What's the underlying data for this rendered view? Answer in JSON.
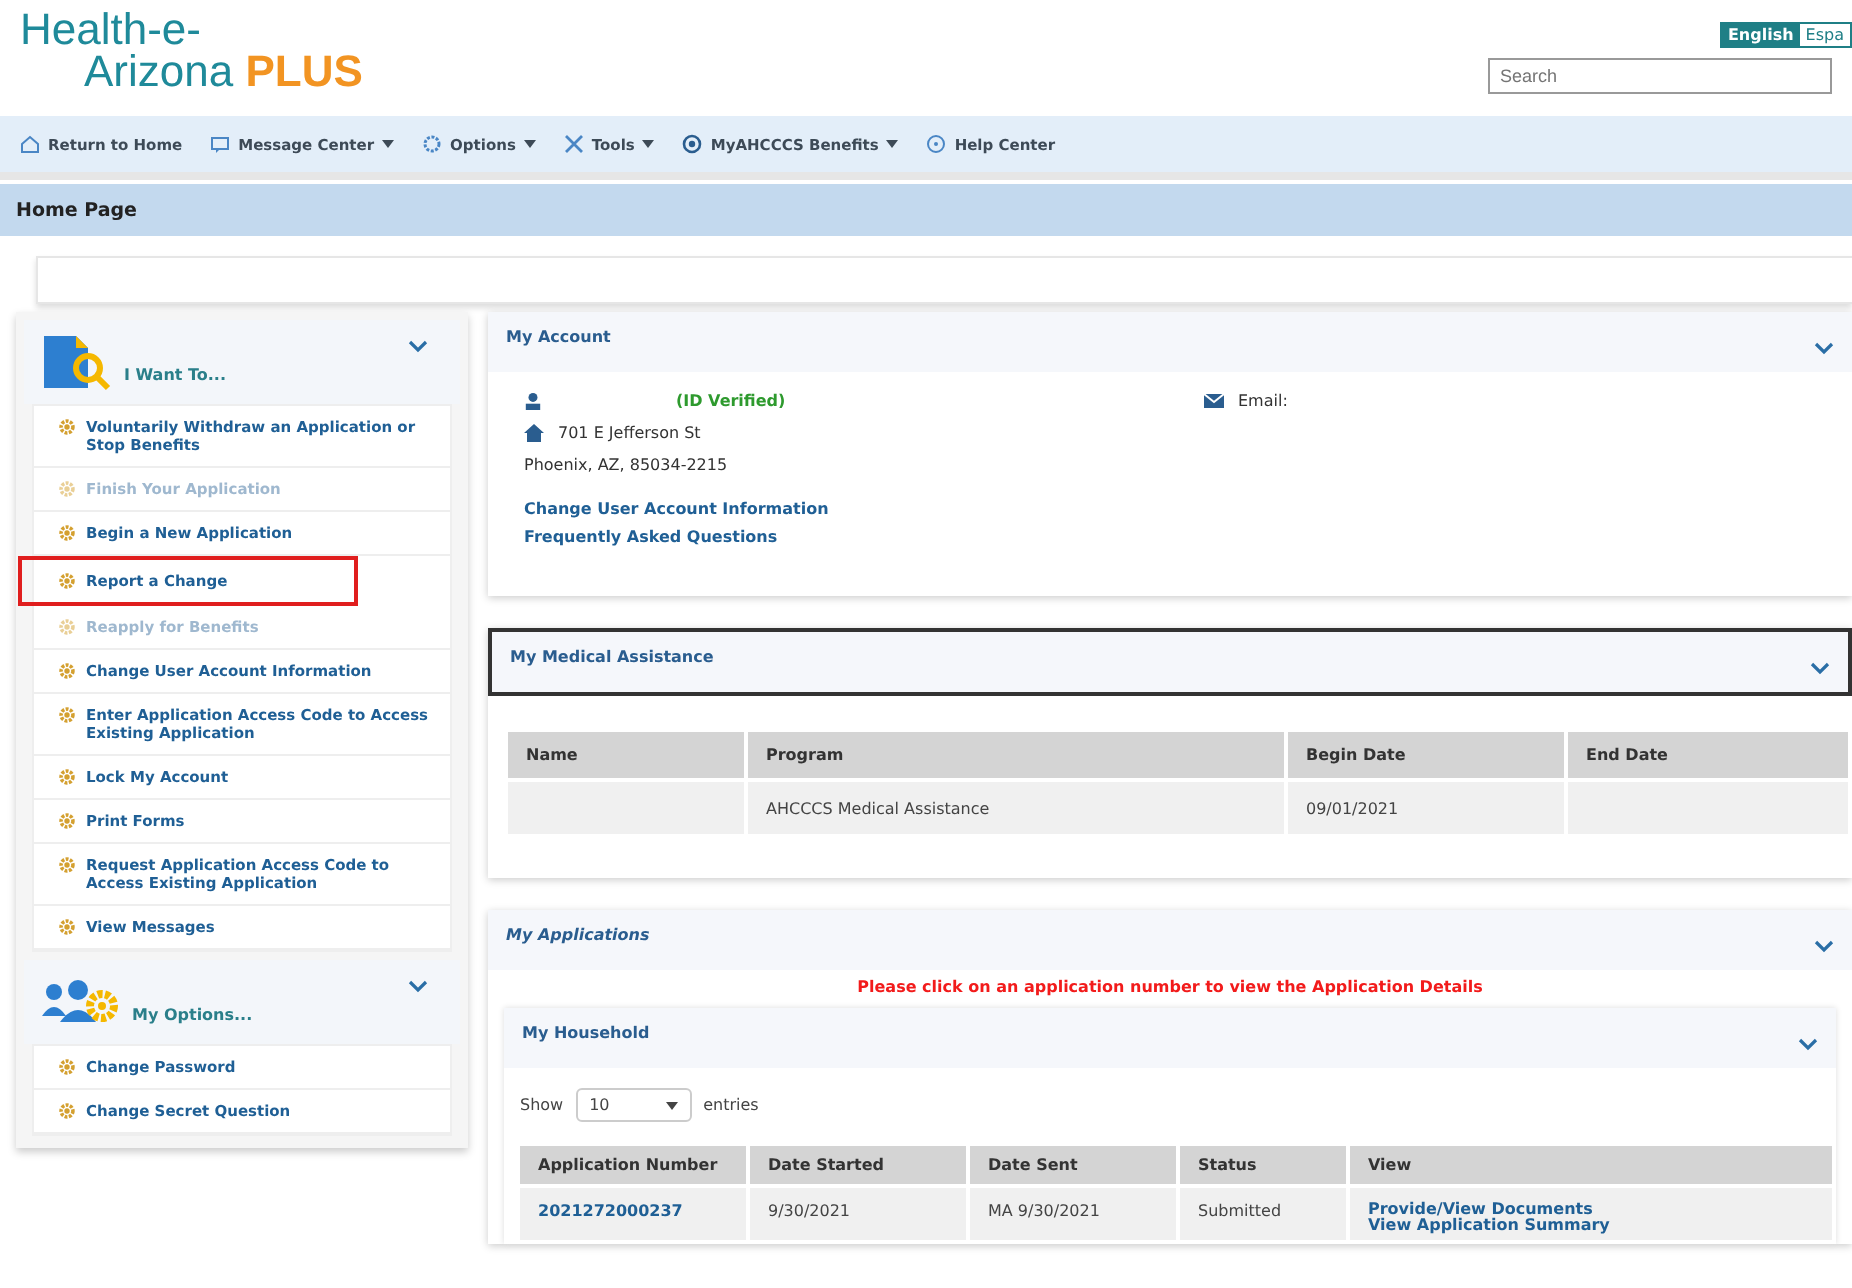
{
  "logo": {
    "line1": "Health-e-",
    "line2": "Arizona",
    "plus": "PLUS"
  },
  "languages": [
    {
      "label": "English",
      "selected": true
    },
    {
      "label": "Espa",
      "selected": false
    }
  ],
  "search": {
    "placeholder": "Search"
  },
  "nav": [
    {
      "label": "Return to Home",
      "dropdown": false
    },
    {
      "label": "Message Center",
      "dropdown": true
    },
    {
      "label": "Options",
      "dropdown": true
    },
    {
      "label": "Tools",
      "dropdown": true
    },
    {
      "label": "MyAHCCCS Benefits",
      "dropdown": true
    },
    {
      "label": "Help Center",
      "dropdown": false
    }
  ],
  "page_title": "Home Page",
  "sidebar": [
    {
      "title": "I Want To...",
      "items": [
        {
          "label": "Voluntarily Withdraw an Application or Stop Benefits",
          "disabled": false,
          "highlighted": false
        },
        {
          "label": "Finish Your Application",
          "disabled": true,
          "highlighted": false
        },
        {
          "label": "Begin a New Application",
          "disabled": false,
          "highlighted": false
        },
        {
          "label": "Report a Change",
          "disabled": false,
          "highlighted": true
        },
        {
          "label": "Reapply for Benefits",
          "disabled": true,
          "highlighted": false
        },
        {
          "label": "Change User Account Information",
          "disabled": false,
          "highlighted": false
        },
        {
          "label": "Enter Application Access Code to Access Existing Application",
          "disabled": false,
          "highlighted": false
        },
        {
          "label": "Lock My Account",
          "disabled": false,
          "highlighted": false
        },
        {
          "label": "Print Forms",
          "disabled": false,
          "highlighted": false
        },
        {
          "label": "Request Application Access Code to Access Existing Application",
          "disabled": false,
          "highlighted": false
        },
        {
          "label": "View Messages",
          "disabled": false,
          "highlighted": false
        }
      ]
    },
    {
      "title": "My Options...",
      "items": [
        {
          "label": "Change Password",
          "disabled": false,
          "highlighted": false
        },
        {
          "label": "Change Secret Question",
          "disabled": false,
          "highlighted": false
        }
      ]
    }
  ],
  "my_account": {
    "title": "My Account",
    "verified": "(ID Verified)",
    "email_label": "Email:",
    "address_line1": "701 E Jefferson St",
    "address_line2": "Phoenix, AZ, 85034-2215",
    "links": [
      "Change User Account Information",
      "Frequently Asked Questions"
    ]
  },
  "medical_assistance": {
    "title": "My Medical Assistance",
    "columns": [
      "Name",
      "Program",
      "Begin Date",
      "End Date"
    ],
    "rows": [
      [
        "",
        "AHCCCS Medical Assistance",
        "09/01/2021",
        ""
      ]
    ]
  },
  "my_applications": {
    "title": "My Applications",
    "notice": "Please click on an application number to view the Application Details"
  },
  "household": {
    "title": "My Household",
    "show_label": "Show",
    "page_size": "10",
    "entries_label": "entries",
    "columns": [
      "Application Number",
      "Date Started",
      "Date Sent",
      "Status",
      "View"
    ],
    "rows": [
      {
        "number": "2021272000237",
        "date_started": "9/30/2021",
        "date_sent": "MA 9/30/2021",
        "status": "Submitted",
        "links": [
          "Provide/View Documents",
          "View Application Summary"
        ]
      }
    ]
  }
}
